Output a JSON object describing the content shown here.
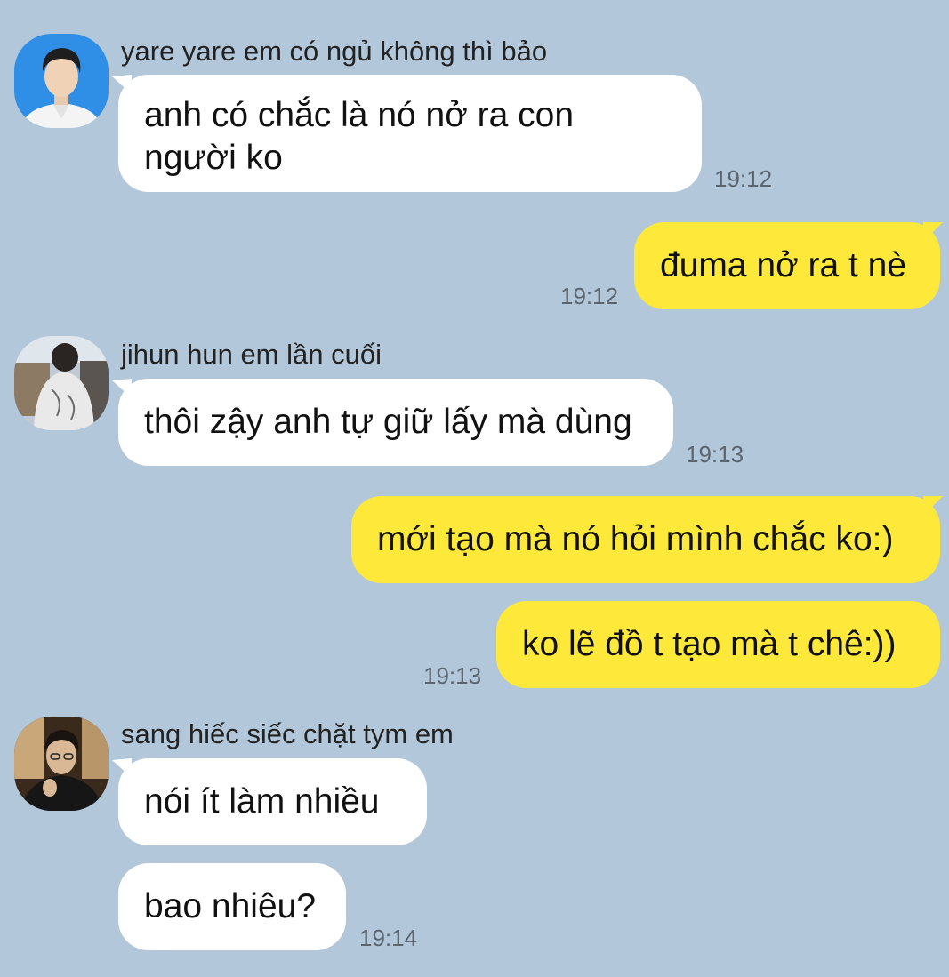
{
  "colors": {
    "background": "#b2c7d9",
    "incoming_bubble": "#ffffff",
    "outgoing_bubble": "#fee93a",
    "timestamp": "#5a6570"
  },
  "messages": {
    "group1": {
      "sender": "yare yare em có ngủ không thì bảo",
      "text": "anh có chắc là nó nở ra con người ko",
      "time": "19:12"
    },
    "out1": {
      "text": "đuma nở ra t nè",
      "time": "19:12"
    },
    "group2": {
      "sender": "jihun hun em lần cuối",
      "text": "thôi zậy anh tự giữ lấy mà dùng",
      "time": "19:13"
    },
    "out2": {
      "text": "mới tạo mà nó hỏi mình chắc ko:)"
    },
    "out3": {
      "text": "ko lẽ đồ t tạo mà t chê:))",
      "time": "19:13"
    },
    "group3": {
      "sender": "sang hiếc siếc chặt tym em",
      "text1": "nói ít làm nhiều",
      "text2": "bao nhiêu?",
      "time": "19:14"
    }
  }
}
